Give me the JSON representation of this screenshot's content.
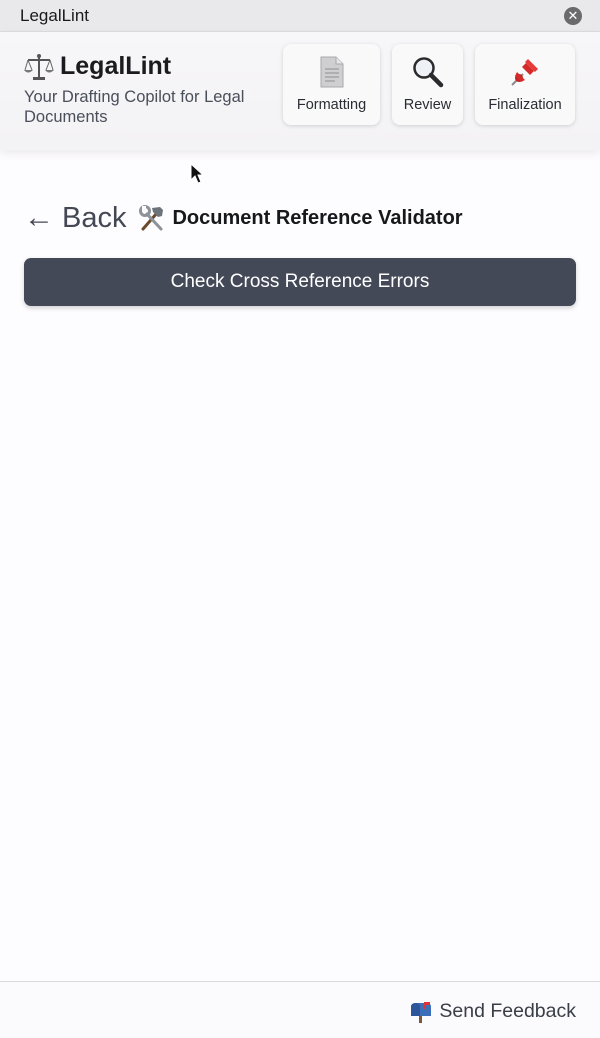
{
  "window": {
    "title": "LegalLint"
  },
  "header": {
    "brand_name": "LegalLint",
    "tagline": "Your Drafting Copilot for Legal Documents",
    "brand_icon": "scales-icon",
    "nav": [
      {
        "label": "Formatting",
        "icon": "document-icon"
      },
      {
        "label": "Review",
        "icon": "magnifier-icon"
      },
      {
        "label": "Finalization",
        "icon": "pushpin-icon"
      }
    ]
  },
  "tool": {
    "back_label": "Back",
    "back_arrow": "←",
    "icon": "hammer-wrench-icon",
    "title": "Document Reference Validator",
    "action_label": "Check Cross Reference Errors"
  },
  "footer": {
    "feedback_label": "Send Feedback",
    "feedback_icon": "mailbox-icon"
  },
  "colors": {
    "primary_button": "#434957",
    "title_bar": "#e9e8ea",
    "background": "#fdfcfe"
  }
}
